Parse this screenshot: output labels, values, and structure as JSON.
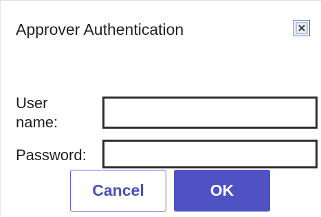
{
  "dialog": {
    "title": "Approver Authentication",
    "close_icon": "close-icon"
  },
  "form": {
    "username_label": "User name:",
    "username_value": "",
    "password_label": "Password:",
    "password_value": ""
  },
  "buttons": {
    "cancel_label": "Cancel",
    "ok_label": "OK"
  },
  "colors": {
    "primary": "#4f52c3",
    "cancel_text": "#4b4fbe",
    "field_border": "#2b2b2b",
    "close_border": "#3b74c9"
  }
}
